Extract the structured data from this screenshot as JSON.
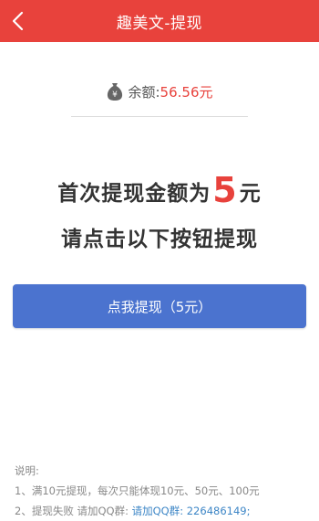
{
  "header": {
    "title": "趣美文-提现",
    "back_icon": "chevron-left-icon"
  },
  "balance": {
    "icon": "money-bag-icon",
    "label": "余额: ",
    "value": "56.56元"
  },
  "headline": {
    "line1_prefix": "首次提现金额为",
    "line1_amount": "5",
    "line1_suffix": "元",
    "line2": "请点击以下按钮提现"
  },
  "button": {
    "label": "点我提现（5元）"
  },
  "notes": {
    "title": "说明:",
    "item1": "1、满10元提现，每次只能体现10元、50元、100元",
    "item2_prefix": "2、提现失败 请加QQ群: ",
    "item2_link": "请加QQ群: 226486149;"
  },
  "colors": {
    "header_bg": "#e8423c",
    "accent_red": "#e8423c",
    "button_bg": "#4b73cf",
    "link_blue": "#3d86c6"
  }
}
